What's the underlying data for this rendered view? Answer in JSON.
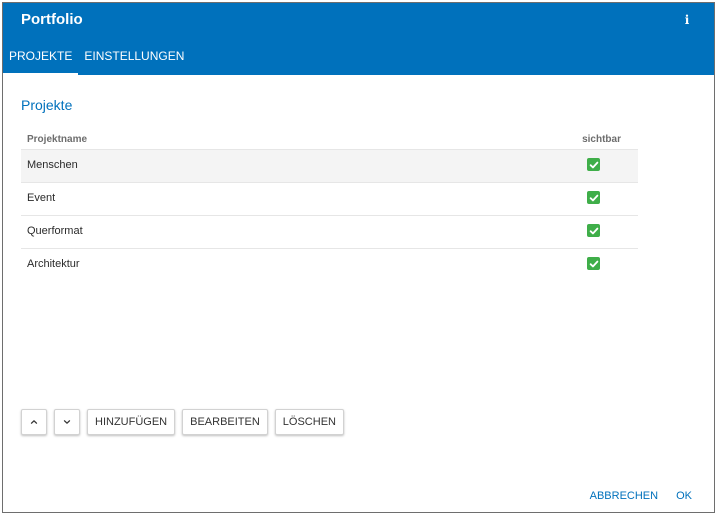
{
  "colors": {
    "primary": "#0071bc",
    "success": "#3fae49",
    "white": "#ffffff"
  },
  "header": {
    "title": "Portfolio",
    "info_icon": "info-icon",
    "info_glyph": "i"
  },
  "tabs": [
    {
      "label": "PROJEKTE",
      "active": true
    },
    {
      "label": "EINSTELLUNGEN",
      "active": false
    }
  ],
  "main": {
    "section_title": "Projekte",
    "columns": {
      "name": "Projektname",
      "visible": "sichtbar"
    },
    "rows": [
      {
        "name": "Menschen",
        "visible": true,
        "selected": true
      },
      {
        "name": "Event",
        "visible": true,
        "selected": false
      },
      {
        "name": "Querformat",
        "visible": true,
        "selected": false
      },
      {
        "name": "Architektur",
        "visible": true,
        "selected": false
      }
    ],
    "checkbox_icon": "check-icon"
  },
  "toolbar": {
    "up_icon": "chevron-up-icon",
    "down_icon": "chevron-down-icon",
    "add_label": "HINZUFÜGEN",
    "edit_label": "BEARBEITEN",
    "delete_label": "LÖSCHEN"
  },
  "footer": {
    "cancel_label": "ABBRECHEN",
    "ok_label": "OK"
  }
}
